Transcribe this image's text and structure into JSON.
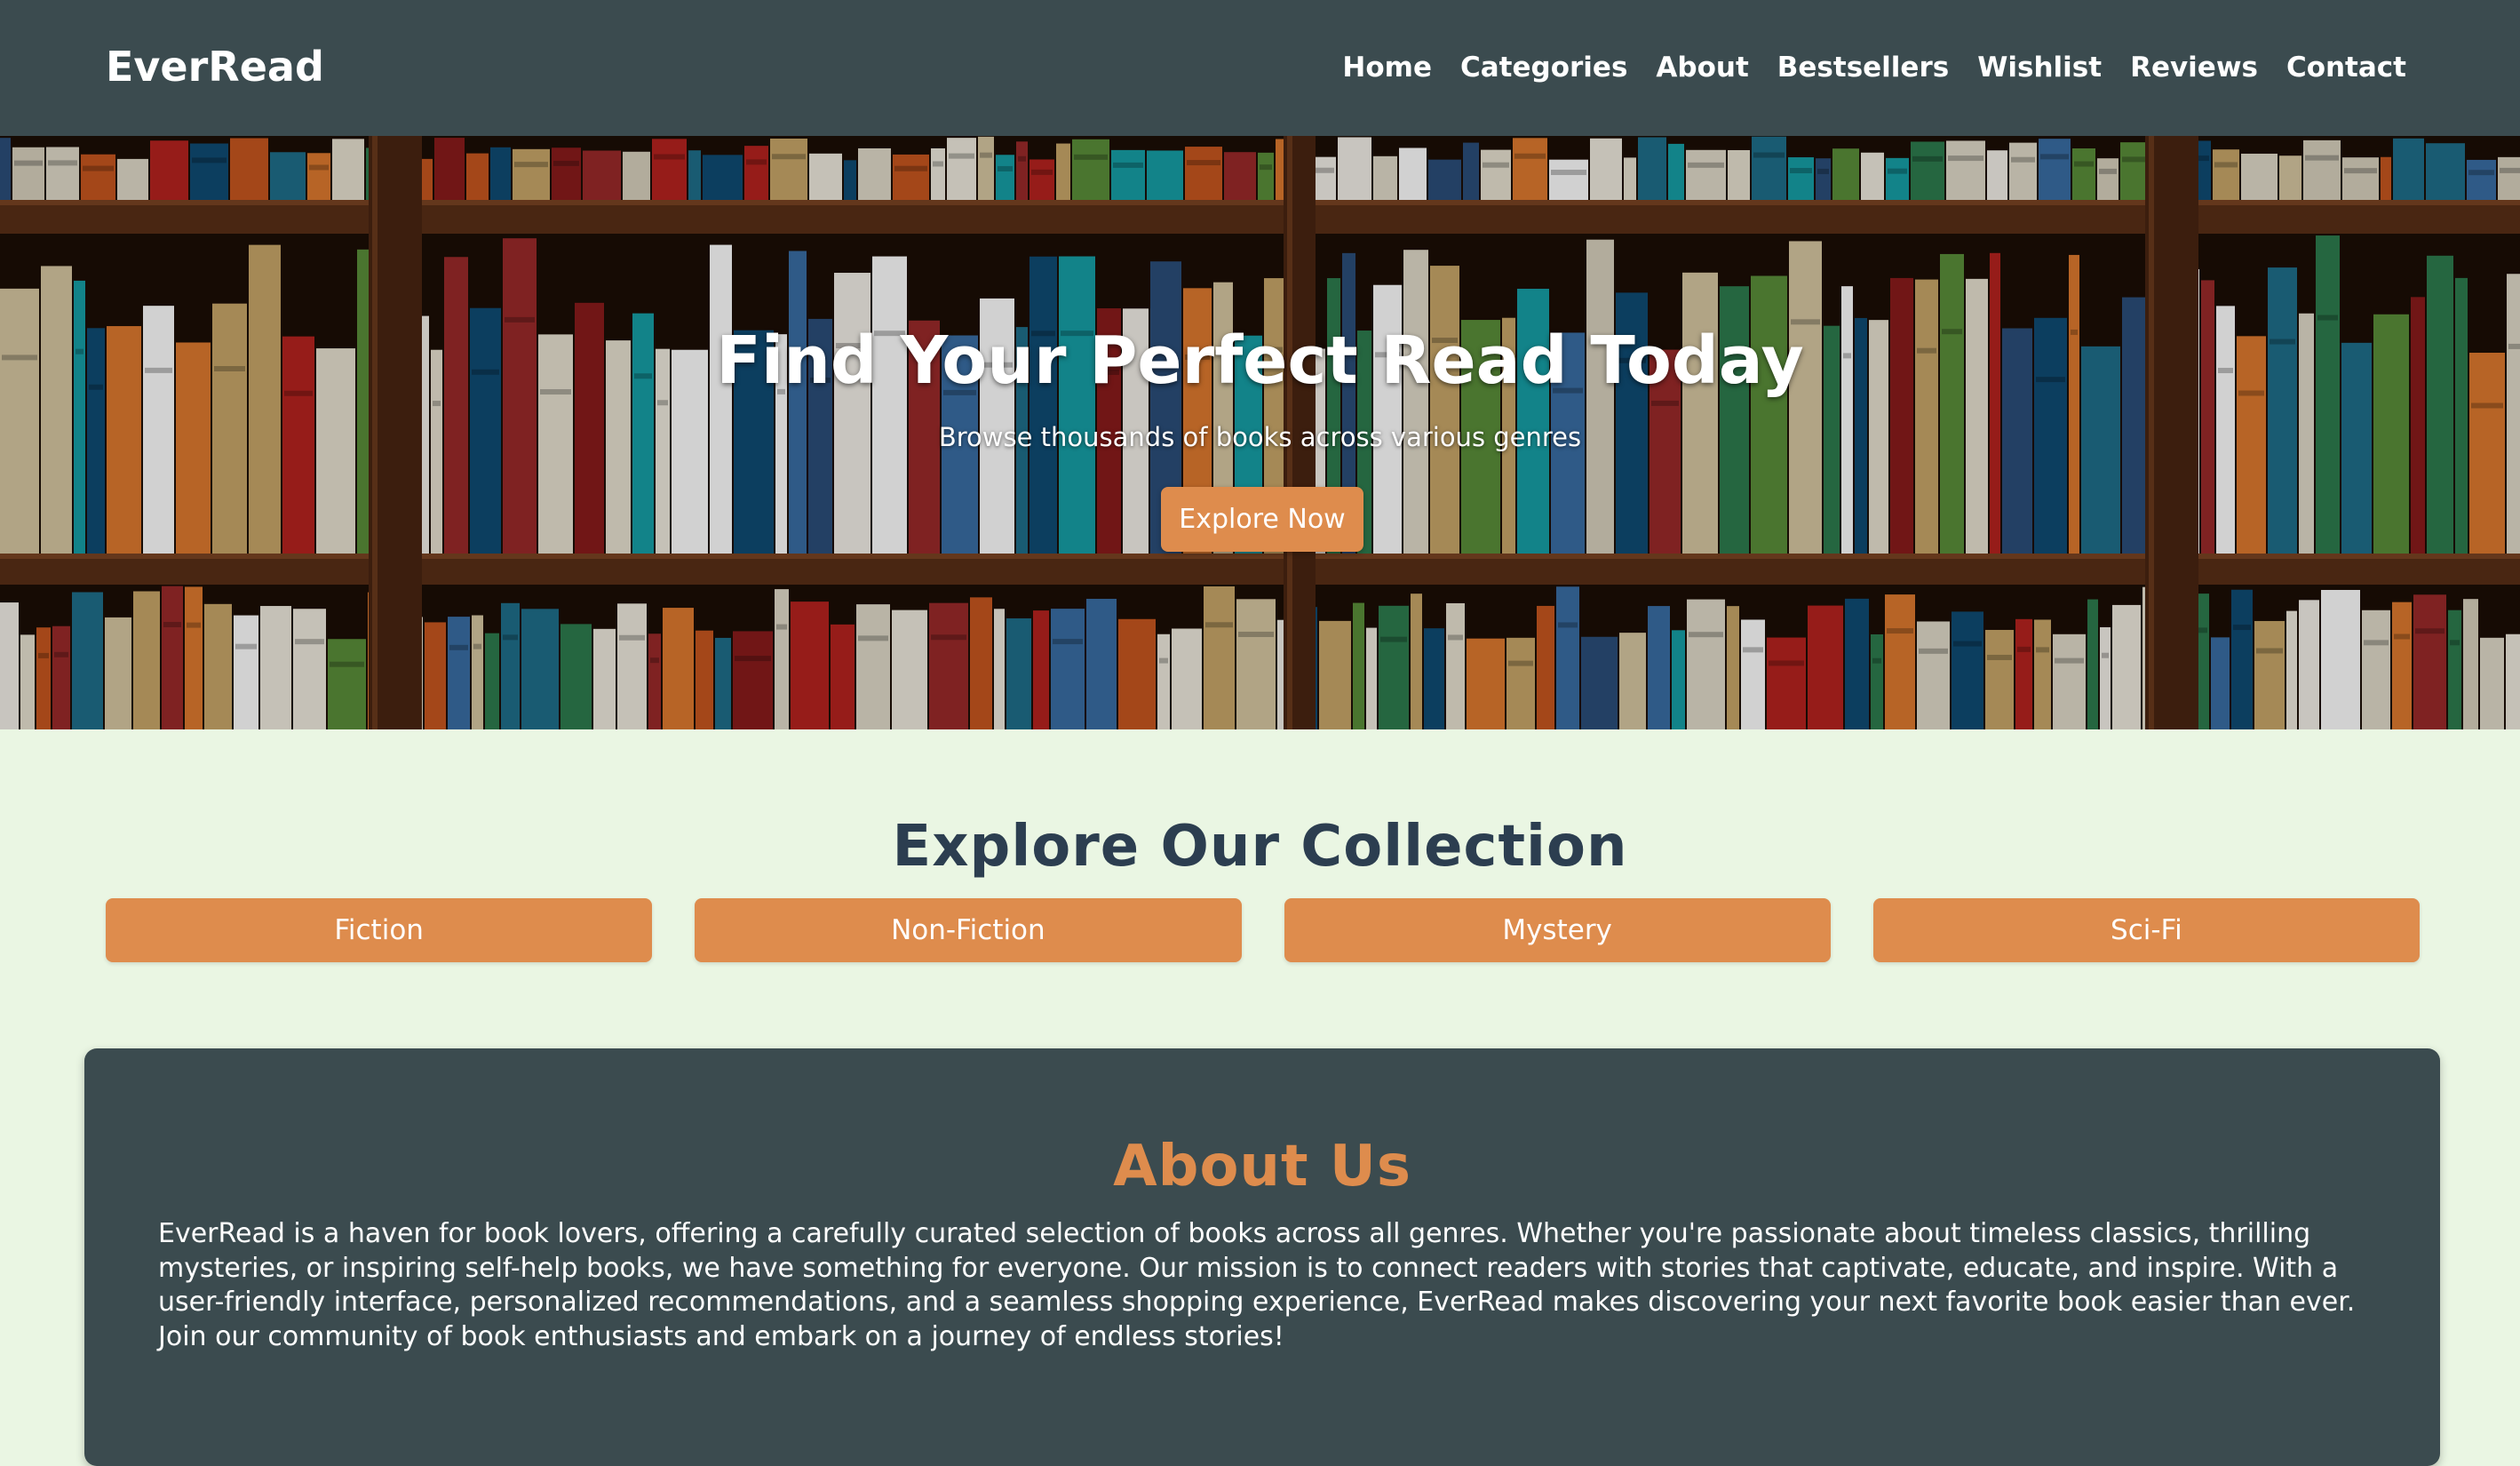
{
  "header": {
    "logo": "EverRead",
    "nav": [
      "Home",
      "Categories",
      "About",
      "Bestsellers",
      "Wishlist",
      "Reviews",
      "Contact"
    ]
  },
  "hero": {
    "title": "Find Your Perfect Read Today",
    "subtitle": "Browse thousands of books across various genres",
    "button_label": "Explore Now"
  },
  "collection": {
    "title": "Explore Our Collection",
    "categories": [
      "Fiction",
      "Non-Fiction",
      "Mystery",
      "Sci-Fi"
    ]
  },
  "about": {
    "title": "About Us",
    "text": "EverRead is a haven for book lovers, offering a carefully curated selection of books across all genres. Whether you're passionate about timeless classics, thrilling mysteries, or inspiring self-help books, we have something for everyone. Our mission is to connect readers with stories that captivate, educate, and inspire. With a user-friendly interface, personalized recommendations, and a seamless shopping experience, EverRead makes discovering your next favorite book easier than ever. Join our community of book enthusiasts and embark on a journey of endless stories!"
  },
  "colors": {
    "header_bg": "#3b4b4f",
    "accent": "#de8c4d",
    "page_bg": "#eaf6e3",
    "heading": "#2c3e50"
  }
}
